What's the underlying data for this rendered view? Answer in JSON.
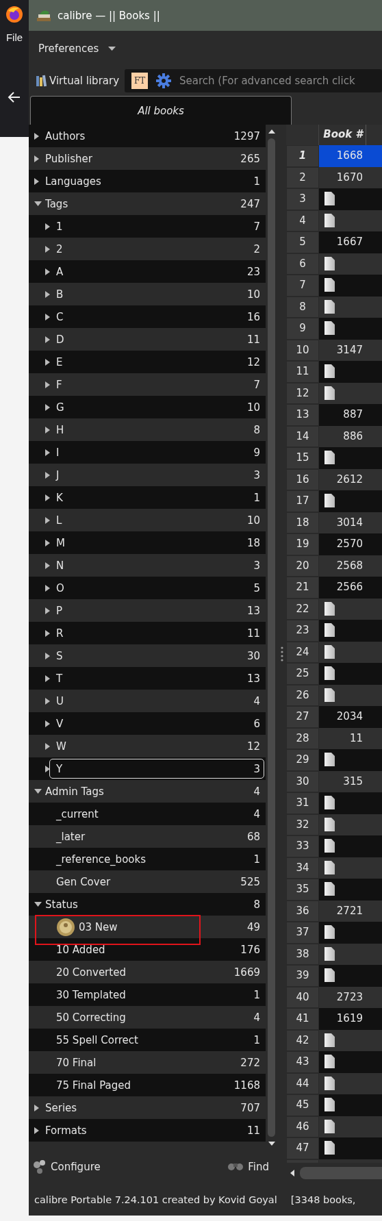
{
  "browser": {
    "menu": "File"
  },
  "window": {
    "title": "calibre — || Books ||"
  },
  "toolbar": {
    "preferences": "Preferences",
    "virtual_library": "Virtual library",
    "search_badge": "FT",
    "search_placeholder": "Search (For advanced search click"
  },
  "tabs": [
    {
      "label": "All books",
      "selected": true
    }
  ],
  "tree": [
    {
      "label": "Authors",
      "count": "1297",
      "expanded": false
    },
    {
      "label": "Publisher",
      "count": "265",
      "expanded": false
    },
    {
      "label": "Languages",
      "count": "1",
      "expanded": false
    },
    {
      "label": "Tags",
      "count": "247",
      "expanded": true,
      "children": [
        {
          "label": "1",
          "count": "7",
          "expanded": false,
          "focused": false
        },
        {
          "label": "2",
          "count": "2",
          "expanded": false,
          "focused": false
        },
        {
          "label": "A",
          "count": "23",
          "expanded": false,
          "focused": false
        },
        {
          "label": "B",
          "count": "10",
          "expanded": false,
          "focused": false
        },
        {
          "label": "C",
          "count": "16",
          "expanded": false,
          "focused": false
        },
        {
          "label": "D",
          "count": "11",
          "expanded": false,
          "focused": false
        },
        {
          "label": "E",
          "count": "12",
          "expanded": false,
          "focused": false
        },
        {
          "label": "F",
          "count": "7",
          "expanded": false,
          "focused": false
        },
        {
          "label": "G",
          "count": "10",
          "expanded": false,
          "focused": false
        },
        {
          "label": "H",
          "count": "8",
          "expanded": false,
          "focused": false
        },
        {
          "label": "I",
          "count": "9",
          "expanded": false,
          "focused": false
        },
        {
          "label": "J",
          "count": "3",
          "expanded": false,
          "focused": false
        },
        {
          "label": "K",
          "count": "1",
          "expanded": false,
          "focused": false
        },
        {
          "label": "L",
          "count": "10",
          "expanded": false,
          "focused": false
        },
        {
          "label": "M",
          "count": "18",
          "expanded": false,
          "focused": false
        },
        {
          "label": "N",
          "count": "3",
          "expanded": false,
          "focused": false
        },
        {
          "label": "O",
          "count": "5",
          "expanded": false,
          "focused": false
        },
        {
          "label": "P",
          "count": "13",
          "expanded": false,
          "focused": false
        },
        {
          "label": "R",
          "count": "11",
          "expanded": false,
          "focused": false
        },
        {
          "label": "S",
          "count": "30",
          "expanded": false,
          "focused": false
        },
        {
          "label": "T",
          "count": "13",
          "expanded": false,
          "focused": false
        },
        {
          "label": "U",
          "count": "4",
          "expanded": false,
          "focused": false
        },
        {
          "label": "V",
          "count": "6",
          "expanded": false,
          "focused": false
        },
        {
          "label": "W",
          "count": "12",
          "expanded": false,
          "focused": false
        },
        {
          "label": "Y",
          "count": "3",
          "expanded": false,
          "focused": true
        }
      ]
    },
    {
      "label": "Admin Tags",
      "count": "4",
      "expanded": true,
      "children": [
        {
          "label": "_current",
          "count": "4"
        },
        {
          "label": "_later",
          "count": "68"
        },
        {
          "label": "_reference_books",
          "count": "1"
        },
        {
          "label": "Gen Cover",
          "count": "525"
        }
      ]
    },
    {
      "label": "Status",
      "count": "8",
      "expanded": true,
      "children": [
        {
          "label": "03 New",
          "count": "49",
          "icon": true,
          "highlighted": true
        },
        {
          "label": "10 Added",
          "count": "176",
          "icon": false,
          "highlighted": false
        },
        {
          "label": "20 Converted",
          "count": "1669",
          "icon": false,
          "highlighted": false
        },
        {
          "label": "30 Templated",
          "count": "1",
          "icon": false,
          "highlighted": false
        },
        {
          "label": "50 Correcting",
          "count": "4",
          "icon": false,
          "highlighted": false
        },
        {
          "label": "55 Spell Correct",
          "count": "1",
          "icon": false,
          "highlighted": false
        },
        {
          "label": "70 Final",
          "count": "272",
          "icon": false,
          "highlighted": false
        },
        {
          "label": "75 Final Paged",
          "count": "1168",
          "icon": false,
          "highlighted": false
        }
      ]
    },
    {
      "label": "Series",
      "count": "707",
      "expanded": false
    },
    {
      "label": "Formats",
      "count": "11",
      "expanded": false
    }
  ],
  "tree_footer": {
    "configure": "Configure",
    "find": "Find"
  },
  "table": {
    "columns": [
      "Book #"
    ],
    "rows": [
      {
        "number": "1",
        "kind": "value",
        "book": "1668",
        "selected": true
      },
      {
        "number": "2",
        "kind": "value",
        "book": "1670",
        "selected": false
      },
      {
        "number": "3",
        "kind": "file",
        "selected": false
      },
      {
        "number": "4",
        "kind": "file",
        "selected": false
      },
      {
        "number": "5",
        "kind": "value",
        "book": "1667",
        "selected": false
      },
      {
        "number": "6",
        "kind": "file",
        "selected": false
      },
      {
        "number": "7",
        "kind": "file",
        "selected": false
      },
      {
        "number": "8",
        "kind": "file",
        "selected": false
      },
      {
        "number": "9",
        "kind": "file",
        "selected": false
      },
      {
        "number": "10",
        "kind": "value",
        "book": "3147",
        "selected": false
      },
      {
        "number": "11",
        "kind": "file",
        "selected": false
      },
      {
        "number": "12",
        "kind": "file",
        "selected": false
      },
      {
        "number": "13",
        "kind": "value",
        "book": "887",
        "selected": false
      },
      {
        "number": "14",
        "kind": "value",
        "book": "886",
        "selected": false
      },
      {
        "number": "15",
        "kind": "file",
        "selected": false
      },
      {
        "number": "16",
        "kind": "value",
        "book": "2612",
        "selected": false
      },
      {
        "number": "17",
        "kind": "file",
        "selected": false
      },
      {
        "number": "18",
        "kind": "value",
        "book": "3014",
        "selected": false
      },
      {
        "number": "19",
        "kind": "value",
        "book": "2570",
        "selected": false
      },
      {
        "number": "20",
        "kind": "value",
        "book": "2568",
        "selected": false
      },
      {
        "number": "21",
        "kind": "value",
        "book": "2566",
        "selected": false
      },
      {
        "number": "22",
        "kind": "file",
        "selected": false
      },
      {
        "number": "23",
        "kind": "file",
        "selected": false
      },
      {
        "number": "24",
        "kind": "file",
        "selected": false
      },
      {
        "number": "25",
        "kind": "file",
        "selected": false
      },
      {
        "number": "26",
        "kind": "file",
        "selected": false
      },
      {
        "number": "27",
        "kind": "value",
        "book": "2034",
        "selected": false
      },
      {
        "number": "28",
        "kind": "value",
        "book": "11",
        "selected": false
      },
      {
        "number": "29",
        "kind": "file",
        "selected": false
      },
      {
        "number": "30",
        "kind": "value",
        "book": "315",
        "selected": false
      },
      {
        "number": "31",
        "kind": "file",
        "selected": false
      },
      {
        "number": "32",
        "kind": "file",
        "selected": false
      },
      {
        "number": "33",
        "kind": "file",
        "selected": false
      },
      {
        "number": "34",
        "kind": "file",
        "selected": false
      },
      {
        "number": "35",
        "kind": "file",
        "selected": false
      },
      {
        "number": "36",
        "kind": "value",
        "book": "2721",
        "selected": false
      },
      {
        "number": "37",
        "kind": "file",
        "selected": false
      },
      {
        "number": "38",
        "kind": "file",
        "selected": false
      },
      {
        "number": "39",
        "kind": "file",
        "selected": false
      },
      {
        "number": "40",
        "kind": "value",
        "book": "2723",
        "selected": false
      },
      {
        "number": "41",
        "kind": "value",
        "book": "1619",
        "selected": false
      },
      {
        "number": "42",
        "kind": "file",
        "selected": false
      },
      {
        "number": "43",
        "kind": "file",
        "selected": false
      },
      {
        "number": "44",
        "kind": "file",
        "selected": false
      },
      {
        "number": "45",
        "kind": "file",
        "selected": false
      },
      {
        "number": "46",
        "kind": "file",
        "selected": false
      },
      {
        "number": "47",
        "kind": "file",
        "selected": false
      }
    ]
  },
  "status_bar": {
    "left": "calibre Portable 7.24.101 created by Kovid Goyal",
    "right": "[3348 books,"
  }
}
